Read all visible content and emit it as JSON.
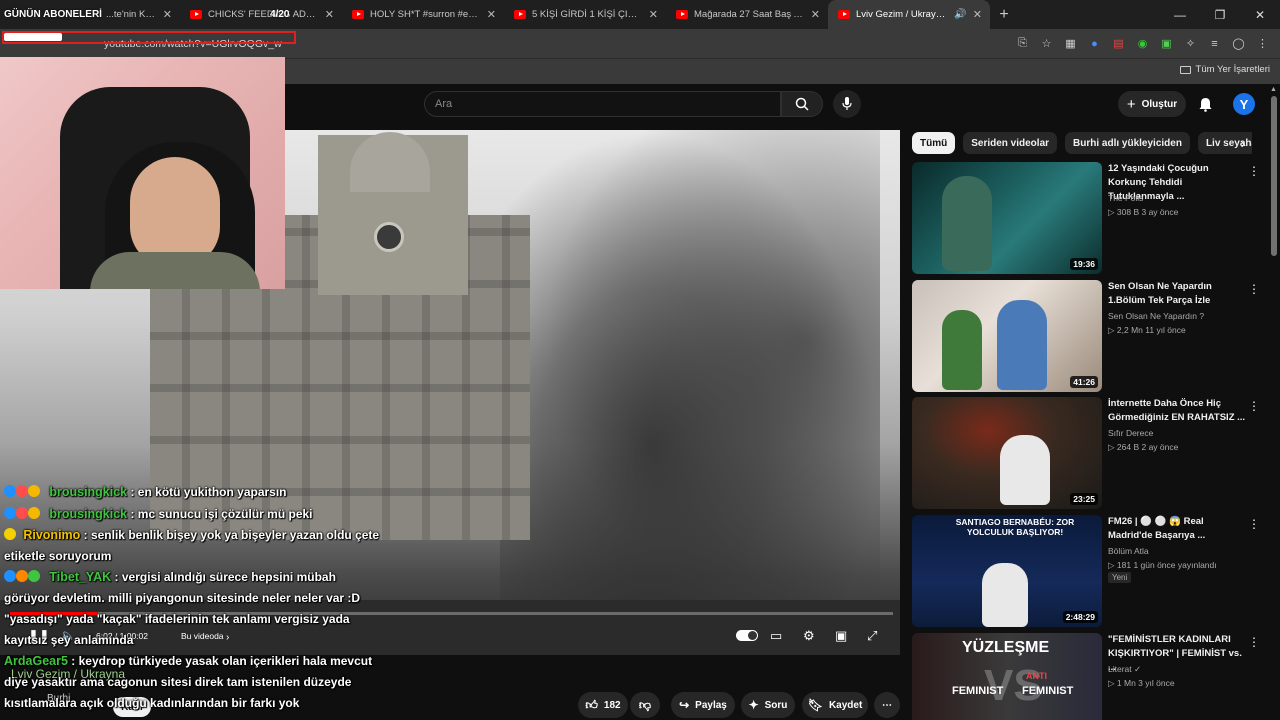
{
  "overlay": {
    "brand": "GÜNÜN ABONELERİ",
    "counter": "4/20"
  },
  "browser": {
    "tabs": [
      {
        "label": "...te'nin Karavan T...",
        "active": false
      },
      {
        "label": "CHICKS' FEEDING ADDICT - Y...",
        "active": false
      },
      {
        "label": "HOLY SH*T #surron #emoto #d",
        "active": false
      },
      {
        "label": "5 KİŞİ GİRDİ 1 KİŞİ ÇIKTI: Gollum",
        "active": false
      },
      {
        "label": "Mağarada 27 Saat Baş Aşağı Sa",
        "active": false
      },
      {
        "label": "Lviv Gezim / Ukrayna - You",
        "active": true
      }
    ],
    "url": "youtube.com/watch?v=UGlrvOQGv_w",
    "all_bookmarks": "Tüm Yer İşaretleri"
  },
  "youtube": {
    "search_placeholder": "Ara",
    "create_label": "Oluştur",
    "avatar_letter": "Y"
  },
  "player": {
    "time": "6:02 / 1:00:02",
    "in_video": "Bu videoda",
    "progress": 0.1
  },
  "chat": [
    {
      "user": "brousingkick",
      "color": "#3fc53f",
      "text": " : en kötü yukithon yaparsın",
      "badges": [
        "#1e90ff",
        "#ff4d4d",
        "#f5b800"
      ]
    },
    {
      "user": "brousingkick",
      "color": "#3fc53f",
      "text": " : mc sunucu işi çözülür mü peki",
      "badges": [
        "#1e90ff",
        "#ff4d4d",
        "#f5b800"
      ]
    },
    {
      "user": "Rivonimo",
      "color": "#f2c200",
      "text": " : senlik benlik bişey yok ya bişeyler yazan oldu çete etiketle soruyorum",
      "badges": [
        "#f5d000"
      ]
    },
    {
      "user": "Tibet_YAK",
      "color": "#3fc53f",
      "text": " : vergisi alındığı sürece hepsini mübah görüyor devletim. milli piyangonun sitesinde neler neler var :D \"yasadışı\" yada \"kaçak\" ifadelerinin tek anlamı vergisiz yada kayıtsız şey anlamında",
      "badges": [
        "#1e90ff",
        "#ff8800",
        "#3fc53f"
      ]
    },
    {
      "user": "ArdaGear5",
      "color": "#3fc53f",
      "text": " : keydrop türkiyede yasak olan içerikleri hala mevcut diye yasaktır ama cagonun sitesi direk tam istenilen düzeyde kısıtlamalara açık olduğu kadınlarından bir farkı yok",
      "badges": []
    }
  ],
  "video_info": {
    "title": "Lviv Gezim / Ukrayna",
    "channel": "Burhi",
    "join": "Katıl",
    "likes": "182",
    "share": "Paylaş",
    "ask": "Soru",
    "save": "Kaydet"
  },
  "chips": [
    "Tümü",
    "Seriden videolar",
    "Burhi adlı yükleyiciden",
    "Liv seyahati"
  ],
  "recommendations": [
    {
      "title": "12 Yaşındaki Çocuğun Korkunç Tehdidi Tutuklanmayla ...",
      "channel": "The Polis",
      "meta": "308 B   3 ay önce",
      "duration": "19:36",
      "new": ""
    },
    {
      "title": "Sen Olsan Ne Yapardın  1.Bölüm Tek Parça İzle",
      "channel": "Sen Olsan Ne Yapardın ?",
      "meta": "2,2 Mn   11 yıl önce",
      "duration": "41:26",
      "new": ""
    },
    {
      "title": "İnternette Daha Önce Hiç Görmediğiniz EN RAHATSIZ ...",
      "channel": "Sıfır Derece",
      "meta": "264 B   2 ay önce",
      "duration": "23:25",
      "new": ""
    },
    {
      "title": "FM26 | ⚪ ⚪ 😱 Real Madrid'de Başarıya ...",
      "channel": "Bölüm Atla",
      "meta": "181   1 gün önce yayınlandı",
      "duration": "2:48:29",
      "new": "Yeni"
    },
    {
      "title": "\"FEMİNİSTLER KADINLARI KIŞKIRTIYOR\" | FEMİNİST vs. ...",
      "channel": "Literat ✓",
      "meta": "1 Mn   3 yıl önce",
      "duration": "",
      "new": ""
    }
  ],
  "thumb_texts": {
    "bernabeu": "SANTIAGO BERNABÉU: ZOR YOLCULUK BAŞLIYOR!",
    "yuzlesme": "YÜZLEŞME",
    "feminist": "FEMINIST",
    "anti": "ANTI",
    "vs": "VS",
    "feminist2": "FEMINIST"
  },
  "colors": {
    "yt_red": "#ff0000",
    "bg": "#0f0f0f",
    "chip_bg": "#272727"
  }
}
